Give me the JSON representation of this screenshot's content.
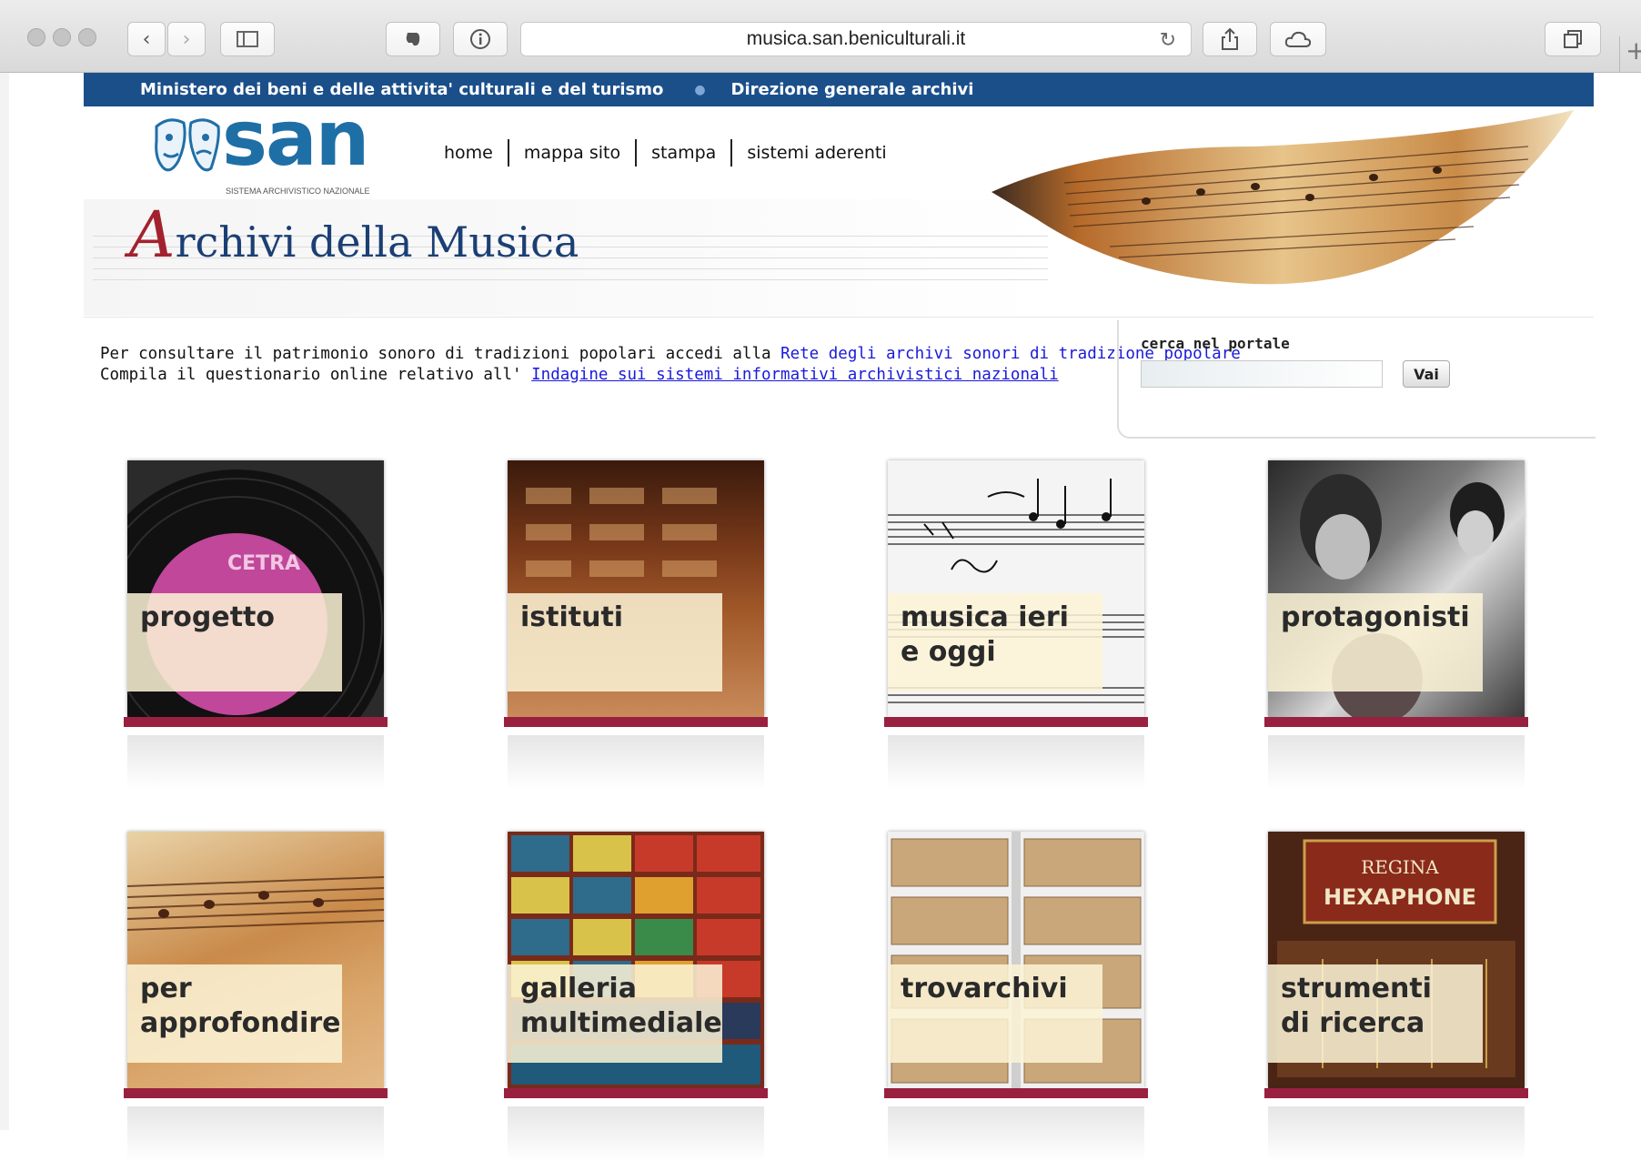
{
  "browser": {
    "url": "musica.san.beniculturali.it"
  },
  "topbar": {
    "ministry": "Ministero dei beni e delle attivita' culturali e del turismo",
    "direction": "Direzione generale archivi"
  },
  "header": {
    "logo_text": "san",
    "logo_sub": "SISTEMA ARCHIVISTICO NAZIONALE",
    "title_initial": "A",
    "title_rest": "rchivi della Musica",
    "nav": [
      "home",
      "mappa sito",
      "stampa",
      "sistemi aderenti"
    ]
  },
  "notice": {
    "line1_text": "Per consultare il patrimonio sonoro di tradizioni popolari accedi alla ",
    "line1_link": "Rete degli archivi sonori di tradizione popolare",
    "line2_text": "Compila il questionario online relativo all' ",
    "line2_link": "Indagine sui sistemi informativi archivistici nazionali"
  },
  "search": {
    "label": "cerca nel portale",
    "placeholder": "",
    "button": "Vai"
  },
  "tiles": [
    {
      "label": "progetto"
    },
    {
      "label": "istituti"
    },
    {
      "label": "musica ieri e oggi"
    },
    {
      "label": "protagonisti"
    },
    {
      "label": "per approfondire"
    },
    {
      "label": "galleria multimediale"
    },
    {
      "label": "trovarchivi"
    },
    {
      "label": "strumenti di ricerca"
    }
  ],
  "record_label": "CETRA",
  "hexaphone": {
    "brand": "REGINA",
    "model": "HEXAPHONE"
  },
  "colors": {
    "topbar": "#1b4f8a",
    "tile_bar": "#9a2040",
    "title": "#1b3f74",
    "link": "#1a1adb"
  }
}
